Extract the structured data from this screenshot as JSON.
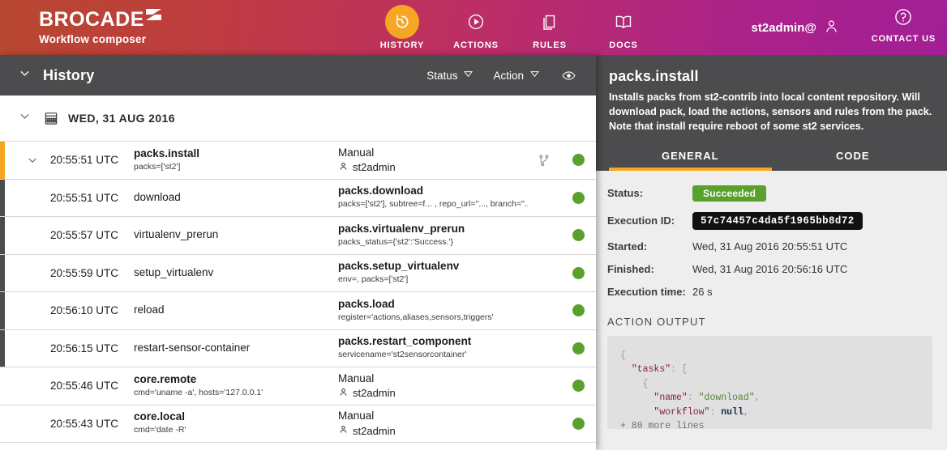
{
  "header": {
    "brand_name": "BROCADE",
    "brand_sub": "Workflow composer",
    "nav": [
      {
        "label": "HISTORY",
        "icon": "history-rewind-icon",
        "active": true
      },
      {
        "label": "ACTIONS",
        "icon": "play-circle-icon",
        "active": false
      },
      {
        "label": "RULES",
        "icon": "pages-stack-icon",
        "active": false
      },
      {
        "label": "DOCS",
        "icon": "open-book-icon",
        "active": false
      }
    ],
    "user": "st2admin@",
    "contact_label": "CONTACT US",
    "accent_active": "#f5a623",
    "gradient_from": "#b8472f",
    "gradient_to": "#a11f96"
  },
  "history": {
    "title": "History",
    "filters": [
      {
        "label": "Status",
        "icon": "chevron-down-icon"
      },
      {
        "label": "Action",
        "icon": "chevron-down-icon"
      }
    ],
    "eye_icon": "eye-icon",
    "group": {
      "label": "WED, 31 AUG 2016",
      "icon": "calendar-icon"
    },
    "rows": [
      {
        "time": "20:55:51 UTC",
        "mid_title": "packs.install",
        "mid_sub": "packs=['st2']",
        "right_title": "Manual",
        "right_user": "st2admin",
        "status": "success",
        "selected": true,
        "child": false,
        "expandable": true,
        "workflow_icon": "workflow-branch-icon"
      },
      {
        "time": "20:55:51 UTC",
        "mid_title": "download",
        "mid_sub": "",
        "right_title": "packs.download",
        "right_sub": "packs=['st2'], subtree=f... , repo_url=\"..., branch=\"...",
        "status": "success",
        "selected": false,
        "child": true,
        "expandable": false
      },
      {
        "time": "20:55:57 UTC",
        "mid_title": "virtualenv_prerun",
        "mid_sub": "",
        "right_title": "packs.virtualenv_prerun",
        "right_sub": "packs_status={'st2':'Success.'}",
        "status": "success",
        "selected": false,
        "child": true,
        "expandable": false
      },
      {
        "time": "20:55:59 UTC",
        "mid_title": "setup_virtualenv",
        "mid_sub": "",
        "right_title": "packs.setup_virtualenv",
        "right_sub": "env=, packs=['st2']",
        "status": "success",
        "selected": false,
        "child": true,
        "expandable": false
      },
      {
        "time": "20:56:10 UTC",
        "mid_title": "reload",
        "mid_sub": "",
        "right_title": "packs.load",
        "right_sub": "register='actions,aliases,sensors,triggers'",
        "status": "success",
        "selected": false,
        "child": true,
        "expandable": false
      },
      {
        "time": "20:56:15 UTC",
        "mid_title": "restart-sensor-container",
        "mid_sub": "",
        "right_title": "packs.restart_component",
        "right_sub": "servicename='st2sensorcontainer'",
        "status": "success",
        "selected": false,
        "child": true,
        "expandable": false
      },
      {
        "time": "20:55:46 UTC",
        "mid_title": "core.remote",
        "mid_sub": "cmd='uname -a', hosts='127.0.0.1'",
        "right_title": "Manual",
        "right_user": "st2admin",
        "status": "success",
        "selected": false,
        "child": false,
        "expandable": false
      },
      {
        "time": "20:55:43 UTC",
        "mid_title": "core.local",
        "mid_sub": "cmd='date -R'",
        "right_title": "Manual",
        "right_user": "st2admin",
        "status": "success",
        "selected": false,
        "child": false,
        "expandable": false
      }
    ],
    "status_color": "#5aa02c"
  },
  "detail": {
    "title": "packs.install",
    "description": "Installs packs from st2-contrib into local content repository. Will download pack, load the actions, sensors and rules from the pack. Note that install require reboot of some st2 services.",
    "tabs": [
      {
        "label": "GENERAL",
        "active": true
      },
      {
        "label": "CODE",
        "active": false
      }
    ],
    "fields": [
      {
        "key": "Status:",
        "value": "Succeeded",
        "kind": "badge"
      },
      {
        "key": "Execution ID:",
        "value": "57c74457c4da5f1965bb8d72",
        "kind": "mono"
      },
      {
        "key": "Started:",
        "value": "Wed, 31 Aug 2016 20:55:51 UTC",
        "kind": "text"
      },
      {
        "key": "Finished:",
        "value": "Wed, 31 Aug 2016 20:56:16 UTC",
        "kind": "text"
      },
      {
        "key": "Execution time:",
        "value": "26 s",
        "kind": "text"
      }
    ],
    "output_label": "ACTION OUTPUT",
    "output_code": {
      "l1": "{",
      "l2_key": "\"tasks\"",
      "l2_rest": ": [",
      "l3": "{",
      "l4_key": "\"name\"",
      "l4_val": "\"download\"",
      "l5_key": "\"workflow\"",
      "l5_val": "null",
      "more": "+ 80 more lines"
    }
  }
}
